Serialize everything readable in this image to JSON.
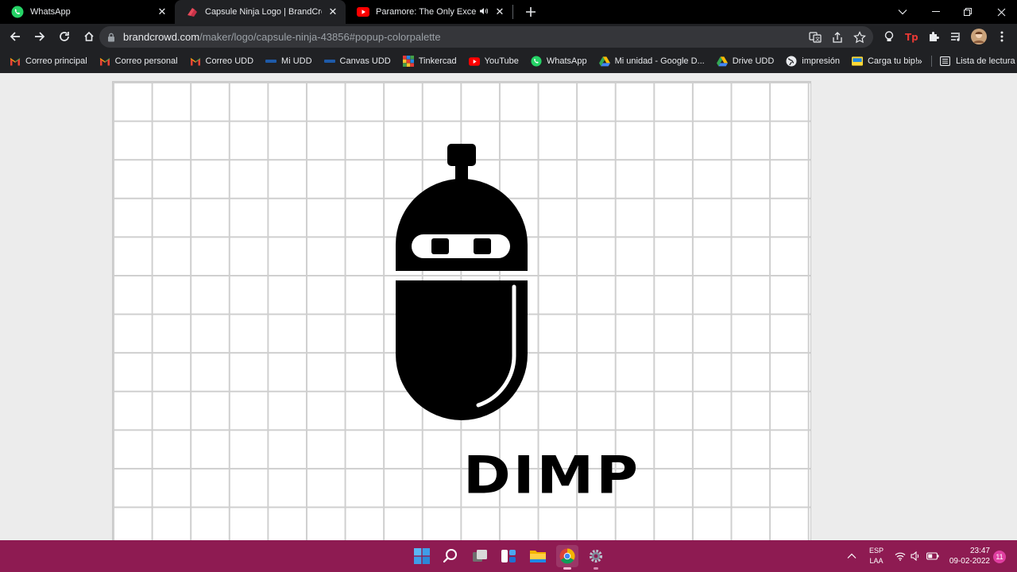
{
  "browser": {
    "tabs": [
      {
        "title": "WhatsApp",
        "icon": "whatsapp-icon"
      },
      {
        "title": "Capsule Ninja Logo | BrandCrowd L",
        "icon": "brandcrowd-icon",
        "active": true
      },
      {
        "title": "Paramore: The Only Exception |",
        "icon": "youtube-icon",
        "audio": "speaker-icon"
      }
    ],
    "address": {
      "host": "brandcrowd.com",
      "path": "/maker/logo/capsule-ninja-43856#popup-colorpalette"
    },
    "bookmarks": [
      {
        "label": "Correo principal",
        "icon": "gmail-icon"
      },
      {
        "label": "Correo personal",
        "icon": "gmail-icon"
      },
      {
        "label": "Correo UDD",
        "icon": "gmail-icon"
      },
      {
        "label": "Mi UDD",
        "icon": "udd-icon"
      },
      {
        "label": "Canvas UDD",
        "icon": "udd-icon"
      },
      {
        "label": "Tinkercad",
        "icon": "tinkercad-icon"
      },
      {
        "label": "YouTube",
        "icon": "youtube-icon"
      },
      {
        "label": "WhatsApp",
        "icon": "whatsapp-icon"
      },
      {
        "label": "Mi unidad - Google D...",
        "icon": "google-drive-icon"
      },
      {
        "label": "Drive UDD",
        "icon": "google-drive-icon"
      },
      {
        "label": "impresión",
        "icon": "globe-icon"
      },
      {
        "label": "Carga tu bip!",
        "icon": "bip-icon"
      }
    ],
    "bookmarks_more": "»",
    "reading_list": "Lista de lectura"
  },
  "logo": {
    "text": "DIMP"
  },
  "taskbar": {
    "lang_top": "ESP",
    "lang_bottom": "LAA",
    "time": "23:47",
    "date": "09-02-2022",
    "notifications": "11"
  },
  "colors": {
    "tabstrip": "#000000",
    "toolbar": "#202124",
    "taskbar": "#8e1b52",
    "whatsapp": "#25d366",
    "youtube": "#ff0000"
  }
}
